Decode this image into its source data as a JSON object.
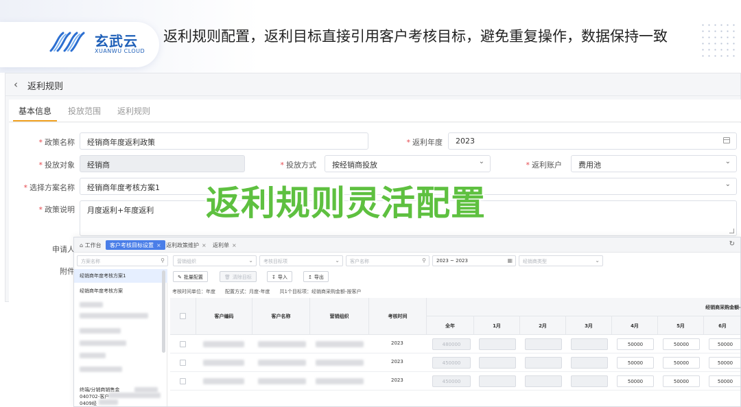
{
  "banner": {
    "logo_cn": "玄武云",
    "logo_en": "XUANWU CLOUD",
    "headline": "返利规则配置，返利目标直接引用客户考核目标，避免重复操作，数据保持一致"
  },
  "page": {
    "back_title": "返利规则",
    "tabs": [
      "基本信息",
      "投放范围",
      "返利规则"
    ],
    "active_tab": "基本信息"
  },
  "form": {
    "policy_name": {
      "label": "政策名称",
      "value": "经销商年度返利政策"
    },
    "rebate_year": {
      "label": "返利年度",
      "value": "2023"
    },
    "target": {
      "label": "投放对象",
      "value": "经销商"
    },
    "method": {
      "label": "投放方式",
      "value": "按经销商投放"
    },
    "account": {
      "label": "返利账户",
      "value": "费用池"
    },
    "scheme": {
      "label": "选择方案名称",
      "value": "经销商年度考核方案1"
    },
    "description": {
      "label": "政策说明",
      "value": "月度返利+年度返利"
    },
    "applicant_label": "申请人",
    "attachment_label": "附件"
  },
  "overlay_title": "返利规则灵活配置",
  "inset": {
    "tabs": [
      {
        "label": "工作台",
        "icon": "home-icon"
      },
      {
        "label": "客户考核目标设置",
        "active": true,
        "closable": true
      },
      {
        "label": "返利政策维护",
        "closable": true
      },
      {
        "label": "返利单",
        "closable": true
      }
    ],
    "filters": {
      "scheme_name": "方案名称",
      "org": "营销组织",
      "target_item": "考核目标项",
      "customer_name": "客户名称",
      "date_range": "2023 ~ 2023",
      "dealer_type": "经销商类型"
    },
    "left_list": {
      "items": [
        "经销商年度考核方案1",
        "经销商年度考核方案"
      ],
      "partial_item_1": "终端/分销商销售金",
      "partial_item_2": "0409经",
      "partial_item_3": "040702-客户"
    },
    "toolbar": {
      "batch": "批量配置",
      "clear": "清除目标",
      "import": "导入",
      "export": "导出"
    },
    "meta": {
      "unit": "考核时间单位：年度",
      "mode": "配置方式：月度-年度",
      "count": "共1个目标项：经销商采购金额-按客户"
    },
    "table": {
      "headers": [
        "客户编码",
        "客户名称",
        "营销组织",
        "考核时间"
      ],
      "group_header": "经销商采购金额-",
      "months": [
        "全年",
        "1月",
        "2月",
        "3月",
        "4月",
        "5月",
        "6月"
      ],
      "rows": [
        {
          "year": "2023",
          "full_year": "480000",
          "m4": "50000",
          "m5": "50000",
          "m6": "50000"
        },
        {
          "year": "2023",
          "full_year": "450000",
          "m4": "50000",
          "m5": "50000",
          "m6": "50000"
        },
        {
          "year": "2023",
          "full_year": "450000",
          "m4": "50000",
          "m5": "50000",
          "m6": "50000"
        }
      ]
    }
  }
}
